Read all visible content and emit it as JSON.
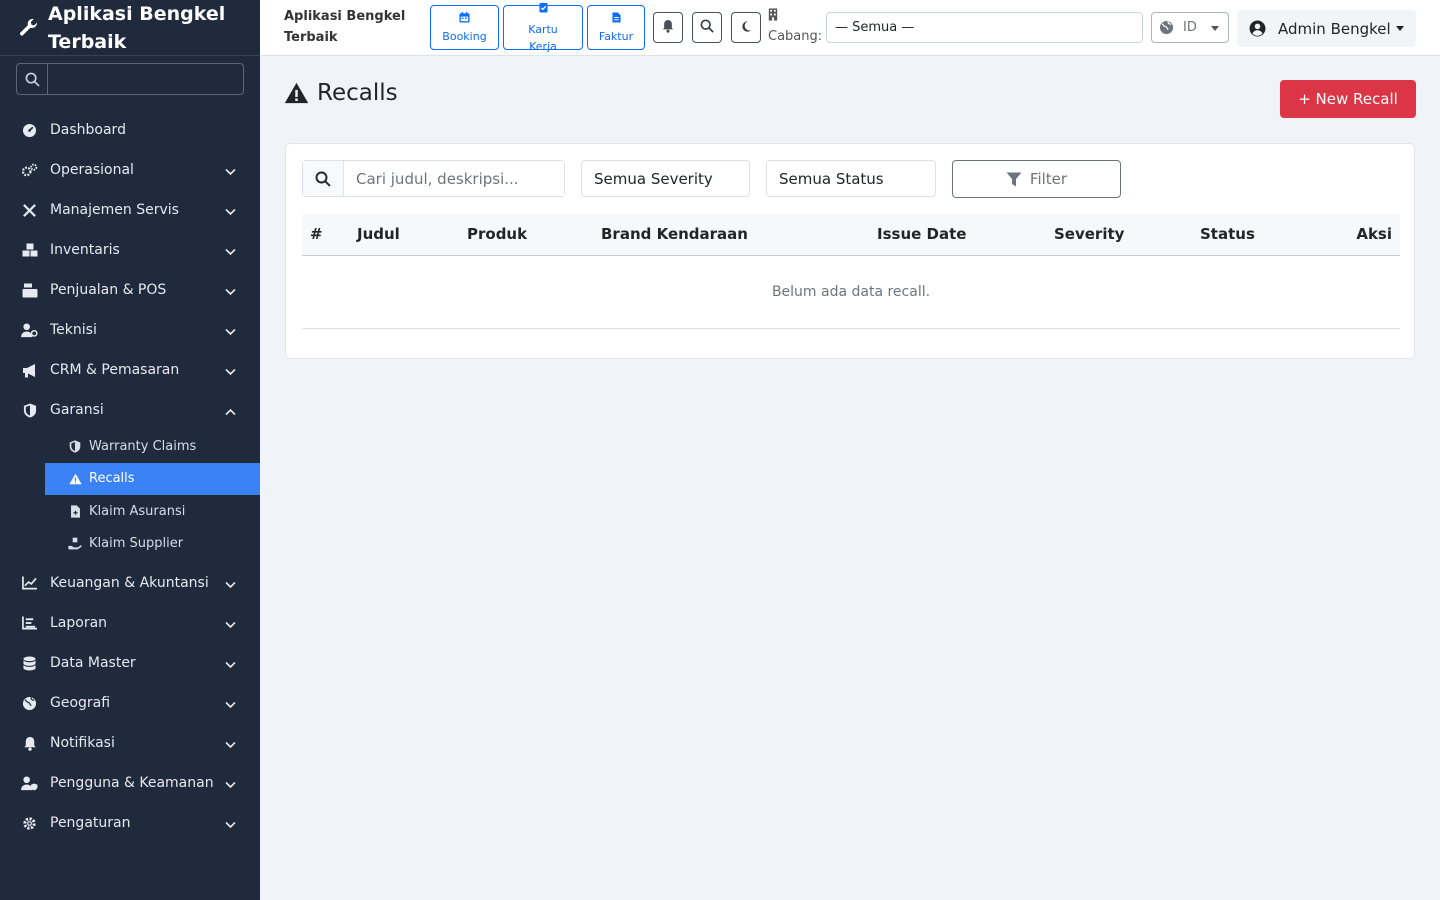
{
  "sidebar": {
    "brand": "Aplikasi Bengkel Terbaik",
    "search_placeholder": "",
    "items": [
      {
        "label": "Dashboard",
        "icon": "dashboard-icon",
        "expandable": false
      },
      {
        "label": "Operasional",
        "icon": "cogs-icon",
        "expandable": true
      },
      {
        "label": "Manajemen Servis",
        "icon": "tools-icon",
        "expandable": true
      },
      {
        "label": "Inventaris",
        "icon": "boxes-icon",
        "expandable": true
      },
      {
        "label": "Penjualan & POS",
        "icon": "cash-register-icon",
        "expandable": true
      },
      {
        "label": "Teknisi",
        "icon": "user-gear-icon",
        "expandable": true
      },
      {
        "label": "CRM & Pemasaran",
        "icon": "bullhorn-icon",
        "expandable": true
      },
      {
        "label": "Garansi",
        "icon": "shield-icon",
        "expandable": true,
        "expanded": true
      },
      {
        "label": "Keuangan & Akuntansi",
        "icon": "chart-line-icon",
        "expandable": true
      },
      {
        "label": "Laporan",
        "icon": "chart-bar-icon",
        "expandable": true
      },
      {
        "label": "Data Master",
        "icon": "database-icon",
        "expandable": true
      },
      {
        "label": "Geografi",
        "icon": "globe-icon",
        "expandable": true
      },
      {
        "label": "Notifikasi",
        "icon": "bell-icon",
        "expandable": true
      },
      {
        "label": "Pengguna & Keamanan",
        "icon": "user-shield-icon",
        "expandable": true
      },
      {
        "label": "Pengaturan",
        "icon": "gear-icon",
        "expandable": true
      }
    ],
    "garansi_sub": [
      {
        "label": "Warranty Claims",
        "icon": "shield-small-icon"
      },
      {
        "label": "Recalls",
        "icon": "warning-icon",
        "active": true
      },
      {
        "label": "Klaim Asuransi",
        "icon": "file-medical-icon"
      },
      {
        "label": "Klaim Supplier",
        "icon": "hand-holding-icon"
      }
    ]
  },
  "topbar": {
    "app_title": "Aplikasi Bengkel Terbaik",
    "quick": [
      {
        "label": "Booking",
        "icon": "calendar-icon"
      },
      {
        "label": "Kartu Kerja",
        "icon": "clipboard-check-icon"
      },
      {
        "label": "Faktur",
        "icon": "invoice-icon"
      }
    ],
    "cabang_label": "Cabang:",
    "cabang_value": "— Semua —",
    "lang_value": "ID",
    "user_name": "Admin Bengkel"
  },
  "main": {
    "title": "Recalls",
    "new_button": "+ New Recall",
    "search_placeholder": "Cari judul, deskripsi...",
    "severity_select": "Semua Severity",
    "status_select": "Semua Status",
    "filter_button": "Filter",
    "columns": [
      "#",
      "Judul",
      "Produk",
      "Brand Kendaraan",
      "Issue Date",
      "Severity",
      "Status",
      "Aksi"
    ],
    "empty_message": "Belum ada data recall."
  },
  "colors": {
    "sidebar_bg": "#1f2a3d",
    "active_item": "#3b82f6",
    "primary": "#0d6efd",
    "danger": "#dc3545"
  }
}
